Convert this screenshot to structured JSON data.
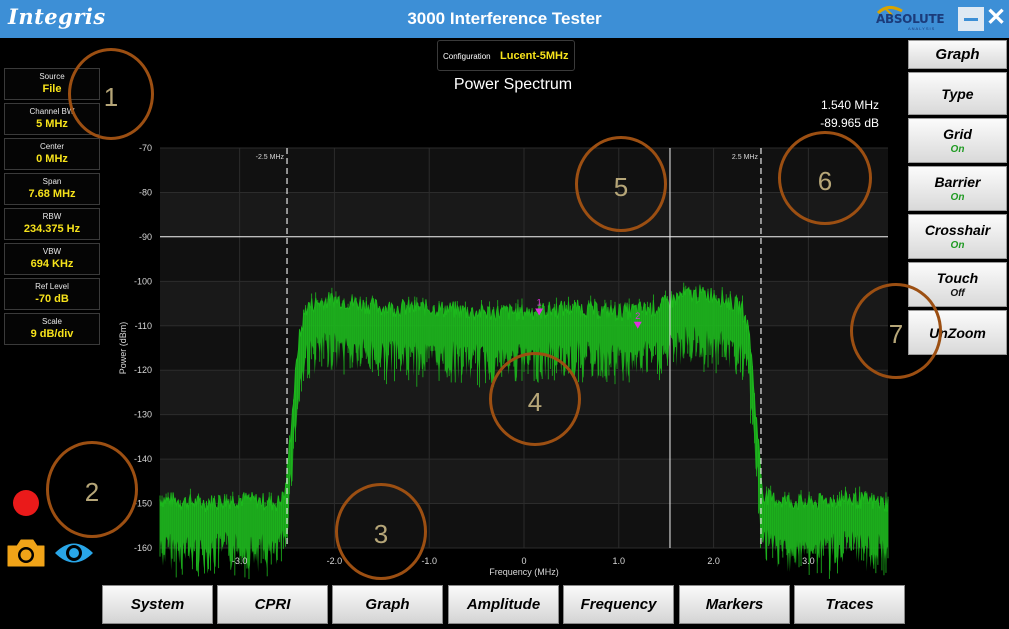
{
  "window": {
    "brand": "Integris",
    "title": "3000 Interference Tester",
    "vendor": "ABSOLUTE",
    "vendor_sub": "ANALYSIS",
    "close_glyph": "✕",
    "accent_color": "#3d8fd6"
  },
  "info_panel": [
    {
      "label": "Source",
      "value": "File"
    },
    {
      "label": "Channel BW",
      "value": "5 MHz"
    },
    {
      "label": "Center",
      "value": "0 MHz"
    },
    {
      "label": "Span",
      "value": "7.68 MHz"
    },
    {
      "label": "RBW",
      "value": "234.375 Hz"
    },
    {
      "label": "VBW",
      "value": "694 KHz"
    },
    {
      "label": "Ref Level",
      "value": "-70 dB"
    },
    {
      "label": "Scale",
      "value": "9 dB/div"
    }
  ],
  "config": {
    "label": "Configuration",
    "value": "Lucent-5MHz"
  },
  "readout": {
    "frequency": "1.540 MHz",
    "level": "-89.965 dB"
  },
  "chart_data": {
    "type": "line",
    "title": "Power Spectrum",
    "xlabel": "Frequency (MHz)",
    "ylabel": "Power (dBm)",
    "xlim": [
      -3.84,
      3.84
    ],
    "ylim": [
      -160,
      -70
    ],
    "x_ticks": [
      -3.0,
      -2.0,
      -1.0,
      0.0,
      1.0,
      2.0,
      3.0
    ],
    "x_tick_labels": [
      "-3.0",
      "-2.0",
      "-1.0",
      "0",
      "1.0",
      "2.0",
      "3.0"
    ],
    "y_ticks": [
      -70,
      -80,
      -90,
      -100,
      -110,
      -120,
      -130,
      -140,
      -150,
      -160
    ],
    "y_tick_labels": [
      "-70",
      "-80",
      "-90",
      "-100",
      "-110",
      "-120",
      "-130",
      "-140",
      "-150",
      "-160"
    ],
    "series": [
      {
        "color": "#1db81d",
        "x": [
          -3.84,
          -3.4,
          -3.0,
          -2.6,
          -2.52,
          -2.45,
          -2.38,
          -2.3,
          -2.2,
          -2.0,
          -1.5,
          -1.0,
          -0.5,
          0.0,
          0.5,
          1.0,
          1.4,
          1.7,
          2.0,
          2.3,
          2.38,
          2.45,
          2.52,
          2.6,
          3.0,
          3.4,
          3.84
        ],
        "y": [
          -153,
          -154,
          -153,
          -154,
          -152,
          -135,
          -118,
          -110,
          -109,
          -108,
          -110,
          -110,
          -111,
          -111,
          -110,
          -111,
          -110,
          -107,
          -107,
          -110,
          -116,
          -135,
          -152,
          -153,
          -154,
          -153,
          -154
        ]
      }
    ],
    "barriers": [
      {
        "x": -2.5,
        "label": "-2.5 MHz"
      },
      {
        "x": 2.5,
        "label": "2.5 MHz"
      }
    ],
    "crosshair": {
      "x": 1.54,
      "y": -89.965
    },
    "markers": [
      {
        "label": "1",
        "x": 0.16,
        "y": -107
      },
      {
        "label": "2",
        "x": 1.2,
        "y": -110
      }
    ],
    "grid": true
  },
  "right_panel": [
    {
      "label": "Graph",
      "state": ""
    },
    {
      "label": "Type",
      "state": ""
    },
    {
      "label": "Grid",
      "state": "On"
    },
    {
      "label": "Barrier",
      "state": "On"
    },
    {
      "label": "Crosshair",
      "state": "On"
    },
    {
      "label": "Touch",
      "state": "Off"
    },
    {
      "label": "UnZoom",
      "state": ""
    }
  ],
  "bottom_tabs": [
    "System",
    "CPRI",
    "Graph",
    "Amplitude",
    "Frequency",
    "Markers",
    "Traces"
  ],
  "icons": {
    "record": "record-icon",
    "camera": "camera-icon",
    "view": "eye-icon"
  },
  "annotations": [
    "1",
    "2",
    "3",
    "4",
    "5",
    "6",
    "7"
  ]
}
